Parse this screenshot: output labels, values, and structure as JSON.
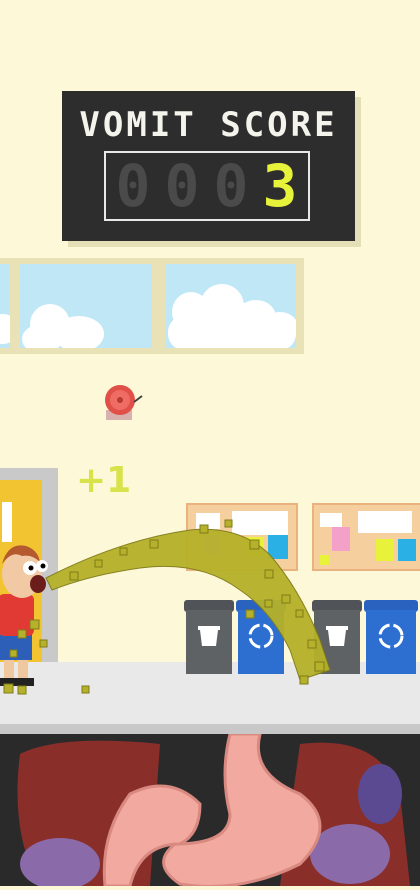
{
  "scoreboard": {
    "title": "VOMIT SCORE",
    "digits": [
      "0",
      "0",
      "0",
      "3"
    ],
    "active_digit_index": 3,
    "score": 3
  },
  "popup": {
    "text": "+1"
  },
  "icons": {
    "bell": "fire-alarm-bell-icon",
    "trash": "trash-can-icon",
    "recycle": "recycle-icon"
  },
  "colors": {
    "wall": "#fdf8d8",
    "scoreboard": "#2d2d2d",
    "score_on": "#e7f23a",
    "score_off": "#4a4a4a",
    "vomit": "#b5b12a",
    "bin_gray": "#5f6265",
    "bin_blue": "#2d6fd1"
  }
}
